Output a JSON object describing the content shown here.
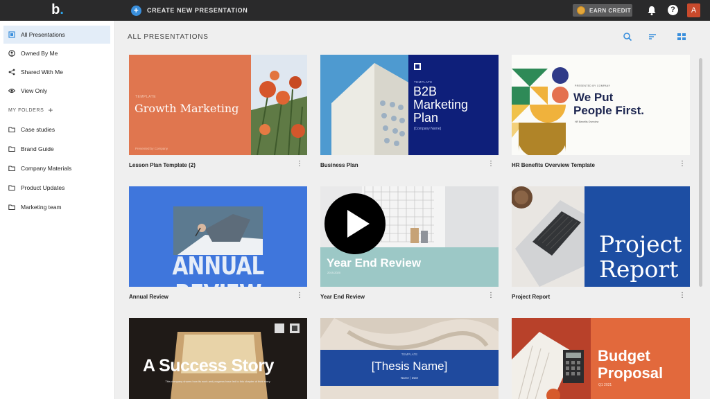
{
  "topbar": {
    "logo": "b",
    "create_label": "CREATE NEW PRESENTATION",
    "earn_label": "EARN CREDIT",
    "help_glyph": "?",
    "avatar_letter": "A"
  },
  "sidebar": {
    "items": [
      {
        "label": "All Presentations",
        "icon": "grid-icon"
      },
      {
        "label": "Owned By Me",
        "icon": "user-icon"
      },
      {
        "label": "Shared With Me",
        "icon": "share-icon"
      },
      {
        "label": "View Only",
        "icon": "eye-icon"
      }
    ],
    "folders_heading": "MY FOLDERS",
    "folders": [
      {
        "label": "Case studies"
      },
      {
        "label": "Brand Guide"
      },
      {
        "label": "Company Materials"
      },
      {
        "label": "Product Updates"
      },
      {
        "label": "Marketing team"
      }
    ]
  },
  "main": {
    "title": "ALL PRESENTATIONS",
    "cards": [
      {
        "name": "Lesson Plan Template (2)",
        "thumb_title": "Growth Marketing",
        "thumb_small": "TEMPLATE",
        "thumb_footer": "Presented by Company"
      },
      {
        "name": "Business Plan",
        "thumb_title_1": "B2B",
        "thumb_title_2": "Marketing",
        "thumb_title_3": "Plan",
        "thumb_small": "TEMPLATE",
        "thumb_sub": "[Company Name]"
      },
      {
        "name": "HR Benefits Overview Template",
        "thumb_title_1": "We Put",
        "thumb_title_2": "People First.",
        "thumb_small": "PRESENTED BY COMPANY",
        "thumb_sub": "HR Benefits Overview"
      },
      {
        "name": "Annual Review",
        "thumb_title": "ANNUAL REVIEW"
      },
      {
        "name": "Year End Review",
        "thumb_title": "Year End Review",
        "thumb_sub": "2019-2020"
      },
      {
        "name": "Project Report",
        "thumb_title_1": "Project",
        "thumb_title_2": "Report"
      },
      {
        "name": "",
        "thumb_title": "A Success Story",
        "thumb_sub": "This company shares how its work and progress have led to this chapter of their story"
      },
      {
        "name": "",
        "thumb_title": "[Thesis Name]",
        "thumb_small": "TEMPLATE",
        "thumb_sub": "Name  |  Date"
      },
      {
        "name": "",
        "thumb_title_1": "Budget",
        "thumb_title_2": "Proposal",
        "thumb_sub": "Q1 2021"
      }
    ],
    "more_glyph": "⋮"
  },
  "colors": {
    "accent": "#3a8fdc",
    "topbar": "#2a2a2b",
    "active_bg": "#e3edf8"
  }
}
